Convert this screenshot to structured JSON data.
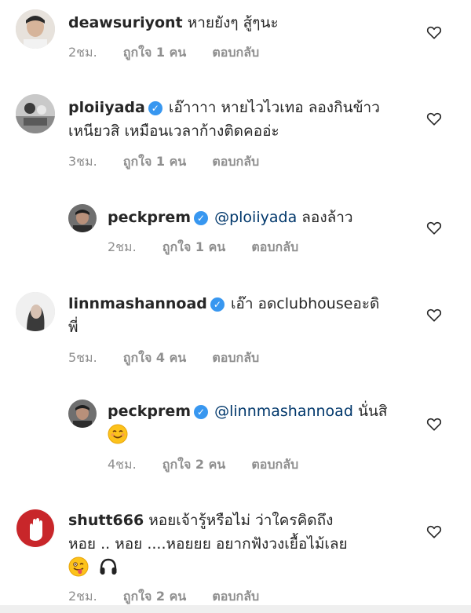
{
  "comments": [
    {
      "username": "deawsuriyont",
      "verified": false,
      "text": "หายยังๆ สู้ๆนะ",
      "time": "2ชม.",
      "likes": "ถูกใจ 1 คน",
      "reply": "ตอบกลับ"
    },
    {
      "username": "ploiiyada",
      "verified": true,
      "text_line1": "เอ๊าาาา หายไวไวเทอ ลองกินข้าว",
      "text_line2": "เหนียวสิ เหมือนเวลาก้างติดคออ่ะ",
      "time": "3ชม.",
      "likes": "ถูกใจ 1 คน",
      "reply": "ตอบกลับ"
    },
    {
      "username": "peckprem",
      "verified": true,
      "mention": "@ploiiyada",
      "text": "ลองล้าว",
      "time": "2ชม.",
      "likes": "ถูกใจ 1 คน",
      "reply": "ตอบกลับ"
    },
    {
      "username": "linnmashannoad",
      "verified": true,
      "text_line1": "เอ๊า อดclubhouseอะดิ",
      "text_line2": "พี่",
      "time": "5ชม.",
      "likes": "ถูกใจ 4 คน",
      "reply": "ตอบกลับ"
    },
    {
      "username": "peckprem",
      "verified": true,
      "mention": "@linnmashannoad",
      "text": "นั่นสิ",
      "emoji": "smiling-face-emoji",
      "time": "4ชม.",
      "likes": "ถูกใจ 2 คน",
      "reply": "ตอบกลับ"
    },
    {
      "username": "shutt666",
      "verified": false,
      "text_line1": "หอยเจ้ารู้หรือไม่ ว่าใครคิดถึง",
      "text_line2": "หอย .. หอย ....หอยยย  อยากฟังวงเยื้อไม้เลย",
      "emojis": [
        "winking-tongue-emoji",
        "headphones-emoji"
      ],
      "time": "2ชม.",
      "likes": "ถูกใจ 2 คน",
      "reply": "ตอบกลับ"
    }
  ],
  "colors": {
    "text": "#262626",
    "meta": "#8e8e8e",
    "mention": "#00376b",
    "verified": "#3897f0"
  }
}
